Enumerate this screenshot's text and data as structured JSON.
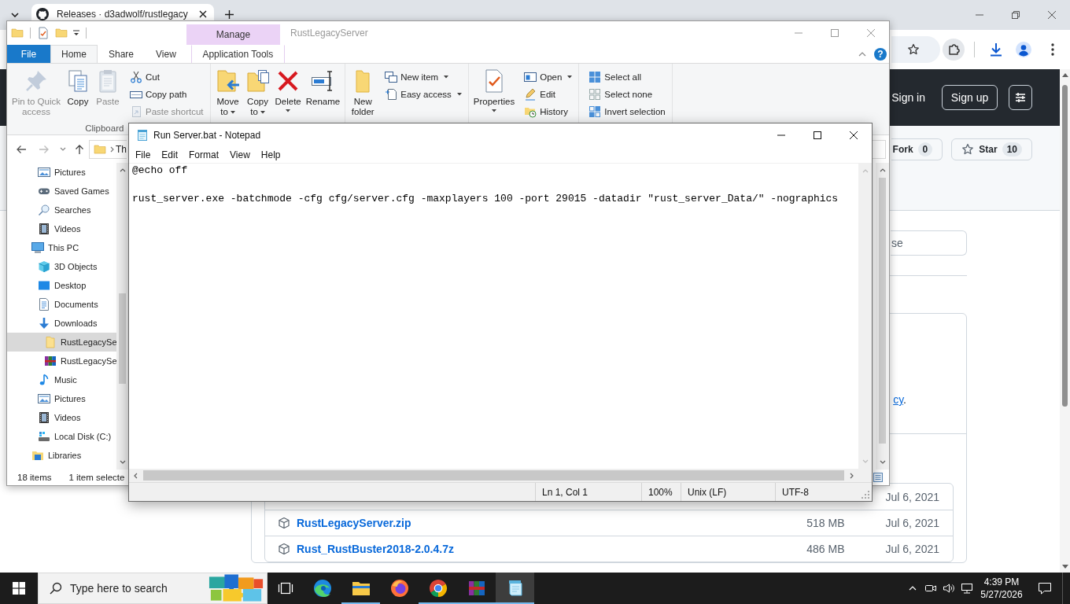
{
  "browser": {
    "tabs": [
      {
        "title": "Releases · d3adwolf/rustlegacy",
        "selected": true
      }
    ],
    "header": {
      "sign_in": "Sign in",
      "sign_up": "Sign up"
    },
    "repo_actions": [
      {
        "kind": "fork",
        "label": "Fork",
        "count": "0"
      },
      {
        "kind": "star",
        "label": "Star",
        "count": "10"
      }
    ],
    "filter": {
      "placeholder": "se"
    },
    "release_note": {
      "link": "cy",
      "tail": "."
    },
    "assets": [
      {
        "date": "Jul 6, 2021"
      },
      {
        "name": "RustLegacyServer.zip",
        "size": "518 MB",
        "date": "Jul 6, 2021"
      },
      {
        "name": "Rust_RustBuster2018-2.0.4.7z",
        "size": "486 MB",
        "date": "Jul 6, 2021"
      }
    ]
  },
  "explorer": {
    "title": "RustLegacyServer",
    "context_header": "Manage",
    "tabs": [
      {
        "label": "File",
        "kind": "file",
        "selected": false
      },
      {
        "label": "Home",
        "kind": "tab",
        "selected": true
      },
      {
        "label": "Share",
        "kind": "tab",
        "selected": false
      },
      {
        "label": "View",
        "kind": "tab",
        "selected": false
      },
      {
        "label": "Application Tools",
        "kind": "contextual",
        "selected": false
      }
    ],
    "help": "?",
    "groups": [
      {
        "label": "Clipboard",
        "buttons": [
          {
            "kind": "pin",
            "large": true,
            "label": "Pin to Quick access",
            "disabled": true
          },
          {
            "kind": "copy",
            "large": true,
            "label": "Copy",
            "disabled": false
          },
          {
            "kind": "paste",
            "large": true,
            "label": "Paste",
            "disabled": true
          },
          {
            "kind": "cut",
            "large": false,
            "label": "Cut",
            "disabled": false
          },
          {
            "kind": "copypath",
            "large": false,
            "label": "Copy path",
            "disabled": false
          },
          {
            "kind": "shortcut",
            "large": false,
            "label": "Paste shortcut",
            "disabled": true
          }
        ]
      },
      {
        "buttons": [
          {
            "kind": "move",
            "large": true,
            "label": "Move to",
            "disabled": false,
            "menu": true
          },
          {
            "kind": "copyto",
            "large": true,
            "label": "Copy to",
            "disabled": false,
            "menu": true
          },
          {
            "kind": "delete",
            "large": true,
            "label": "Delete",
            "disabled": false,
            "menu": true
          },
          {
            "kind": "rename",
            "large": true,
            "label": "Rename",
            "disabled": false
          }
        ]
      },
      {
        "buttons": [
          {
            "kind": "newfolder",
            "large": true,
            "label": "New folder",
            "disabled": false
          },
          {
            "kind": "newitem",
            "large": false,
            "label": "New item",
            "disabled": false,
            "menu": true
          },
          {
            "kind": "easyaccess",
            "large": false,
            "label": "Easy access",
            "disabled": false,
            "menu": true
          }
        ]
      },
      {
        "buttons": [
          {
            "kind": "properties",
            "large": true,
            "label": "Properties",
            "disabled": false,
            "menu": true
          },
          {
            "kind": "open",
            "large": false,
            "label": "Open",
            "disabled": false,
            "menu": true
          },
          {
            "kind": "edit",
            "large": false,
            "label": "Edit",
            "disabled": false
          },
          {
            "kind": "history",
            "large": false,
            "label": "History",
            "disabled": false
          }
        ]
      },
      {
        "buttons": [
          {
            "kind": "selectall",
            "large": false,
            "label": "Select all",
            "disabled": false
          },
          {
            "kind": "selectnone",
            "large": false,
            "label": "Select none",
            "disabled": false
          },
          {
            "kind": "invert",
            "large": false,
            "label": "Invert selection",
            "disabled": false
          }
        ]
      }
    ],
    "address": {
      "crumb": "Th"
    },
    "nav_pane": {
      "continued": [
        {
          "label": "Pictures",
          "kind": "pictures",
          "selected": false
        },
        {
          "label": "Saved Games",
          "kind": "games",
          "selected": false
        },
        {
          "label": "Searches",
          "kind": "search",
          "selected": false
        },
        {
          "label": "Videos",
          "kind": "videos",
          "selected": false
        }
      ],
      "tree": [
        {
          "label": "This PC",
          "kind": "pc",
          "selected": false,
          "children": [
            {
              "label": "3D Objects",
              "kind": "objects",
              "selected": false
            },
            {
              "label": "Desktop",
              "kind": "desktop",
              "selected": false
            },
            {
              "label": "Documents",
              "kind": "documents",
              "selected": false
            },
            {
              "label": "Downloads",
              "kind": "downloads",
              "selected": false,
              "children": [
                {
                  "label": "RustLegacySe",
                  "kind": "folder",
                  "selected": true
                },
                {
                  "label": "RustLegacySe",
                  "kind": "archive",
                  "selected": false
                }
              ]
            },
            {
              "label": "Music",
              "kind": "music",
              "selected": false
            },
            {
              "label": "Pictures",
              "kind": "pictures",
              "selected": false
            },
            {
              "label": "Videos",
              "kind": "videos",
              "selected": false
            },
            {
              "label": "Local Disk (C:)",
              "kind": "disk",
              "selected": false
            }
          ]
        },
        {
          "label": "Libraries",
          "kind": "libraries",
          "selected": false
        }
      ]
    },
    "status": {
      "items": "18 items",
      "selection": "1 item selecte"
    }
  },
  "notepad": {
    "title": "Run Server.bat - Notepad",
    "menu": [
      "File",
      "Edit",
      "Format",
      "View",
      "Help"
    ],
    "text": "@echo off\n\nrust_server.exe -batchmode -cfg cfg/server.cfg -maxplayers 100 -port 29015 -datadir \"rust_server_Data/\" -nographics",
    "status": [
      "Ln 1, Col 1",
      "100%",
      "Unix (LF)",
      "UTF-8"
    ]
  },
  "taskbar": {
    "search": {
      "placeholder": "Type here to search"
    },
    "apps": [
      {
        "kind": "taskview",
        "running": false,
        "selected": false
      },
      {
        "kind": "edge",
        "running": false,
        "selected": false
      },
      {
        "kind": "explorer",
        "running": true,
        "selected": false
      },
      {
        "kind": "firefox",
        "running": false,
        "selected": false
      },
      {
        "kind": "chrome",
        "running": true,
        "selected": false
      },
      {
        "kind": "winrar",
        "running": true,
        "selected": false
      },
      {
        "kind": "notepad",
        "running": true,
        "selected": true
      }
    ],
    "clock": {
      "time": "4:39 PM",
      "date": "5/27/2026"
    }
  }
}
